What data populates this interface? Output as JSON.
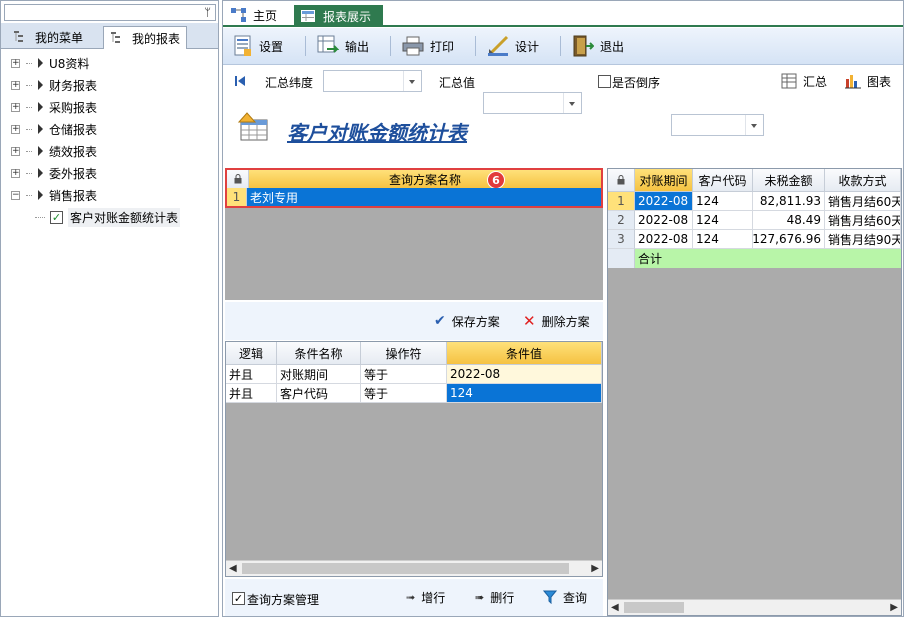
{
  "left": {
    "pin": "ᛘ",
    "tabs": [
      "我的菜单",
      "我的报表"
    ],
    "tree": [
      "U8资料",
      "财务报表",
      "采购报表",
      "仓储报表",
      "绩效报表",
      "委外报表",
      "销售报表"
    ],
    "child": "客户对账金额统计表"
  },
  "tabs": {
    "home": "主页",
    "report": "报表展示"
  },
  "toolbar": {
    "settings": "设置",
    "export": "输出",
    "print": "打印",
    "design": "设计",
    "exit": "退出"
  },
  "filter": {
    "dimension_label": "汇总纬度",
    "value_label": "汇总值",
    "reverse_label": "是否倒序",
    "summary_button": "汇总",
    "chart_button": "图表"
  },
  "report_title": "客户对账金额统计表",
  "scheme_grid": {
    "header": "查询方案名称",
    "badge": "6",
    "rows": [
      {
        "num": "1",
        "name": "老刘专用"
      }
    ],
    "save_button": "保存方案",
    "delete_button": "删除方案"
  },
  "cond_grid": {
    "headers": [
      "逻辑",
      "条件名称",
      "操作符",
      "条件值"
    ],
    "rows": [
      [
        "并且",
        "对账期间",
        "等于",
        "2022-08"
      ],
      [
        "并且",
        "客户代码",
        "等于",
        "124"
      ]
    ]
  },
  "bottom": {
    "manage_label": "查询方案管理",
    "add_row": "增行",
    "delete_row": "删行",
    "query": "查询"
  },
  "result_grid": {
    "headers": [
      "对账期间",
      "客户代码",
      "未税金额",
      "收款方式"
    ],
    "rows": [
      {
        "num": "1",
        "cells": [
          "2022-08",
          "124",
          "82,811.93",
          "销售月结60天"
        ]
      },
      {
        "num": "2",
        "cells": [
          "2022-08",
          "124",
          "48.49",
          "销售月结60天"
        ]
      },
      {
        "num": "3",
        "cells": [
          "2022-08",
          "124",
          "127,676.96",
          "销售月结90天"
        ]
      }
    ],
    "total_label": "合计"
  }
}
